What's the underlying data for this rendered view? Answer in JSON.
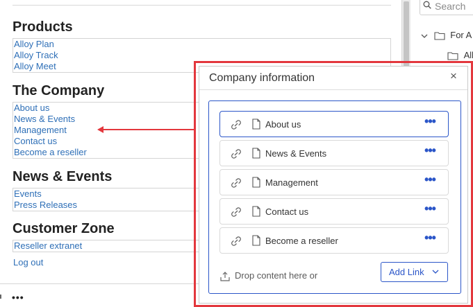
{
  "preview": {
    "sections": [
      {
        "title": "Products",
        "links": [
          "Alloy Plan",
          "Alloy Track",
          "Alloy Meet"
        ]
      },
      {
        "title": "The Company",
        "links": [
          "About us",
          "News & Events",
          "Management",
          "Contact us",
          "Become a reseller"
        ]
      },
      {
        "title": "News & Events",
        "links": [
          "Events",
          "Press Releases"
        ]
      },
      {
        "title": "Customer Zone",
        "links": [
          "Reseller extranet"
        ]
      }
    ],
    "logout": "Log out"
  },
  "right_panel": {
    "search_placeholder": "Search",
    "tree": [
      {
        "label": "For A",
        "icon": "folder-icon",
        "expanded": true
      },
      {
        "label": "All",
        "icon": "folder-icon"
      }
    ]
  },
  "dialog": {
    "title": "Company information",
    "close_symbol": "×",
    "items": [
      {
        "label": "About us",
        "selected": true
      },
      {
        "label": "News & Events"
      },
      {
        "label": "Management"
      },
      {
        "label": "Contact us"
      },
      {
        "label": "Become a reseller"
      }
    ],
    "more_symbol": "•••",
    "drop_text": "Drop content here or",
    "add_link_label": "Add Link"
  },
  "footer": {
    "dots": "•••"
  },
  "colors": {
    "accent": "#2a55c8",
    "highlight": "#e3373d",
    "link": "#2e6fb7"
  }
}
